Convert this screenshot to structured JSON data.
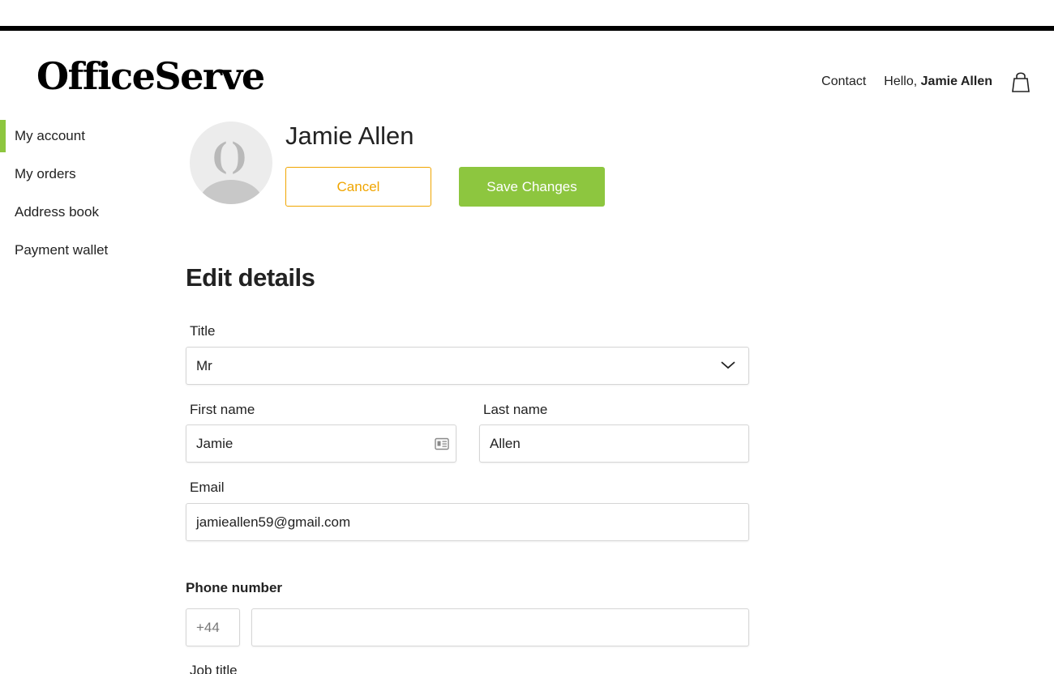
{
  "brand": {
    "logo_text": "OfficeServe",
    "accent": "#8dc63f",
    "warning": "#f0a500"
  },
  "header": {
    "contact_label": "Contact",
    "greeting": "Hello,",
    "user_name": "Jamie Allen",
    "cart_icon": "shopping-bag-icon"
  },
  "sidebar": {
    "items": [
      {
        "label": "My account",
        "active": true
      },
      {
        "label": "My orders"
      },
      {
        "label": "Address book"
      },
      {
        "label": "Payment wallet"
      }
    ]
  },
  "profile": {
    "name": "Jamie Allen",
    "cancel_label": "Cancel",
    "save_label": "Save Changes"
  },
  "form": {
    "section_title": "Edit details",
    "title_label": "Title",
    "title_value": "Mr",
    "first_name_label": "First name",
    "first_name_value": "Jamie",
    "last_name_label": "Last name",
    "last_name_value": "Allen",
    "email_label": "Email",
    "email_value": "jamieallen59@gmail.com",
    "phone_section": "Phone number",
    "phone_prefix": "+44",
    "phone_value": "",
    "job_title_label": "Job title"
  }
}
